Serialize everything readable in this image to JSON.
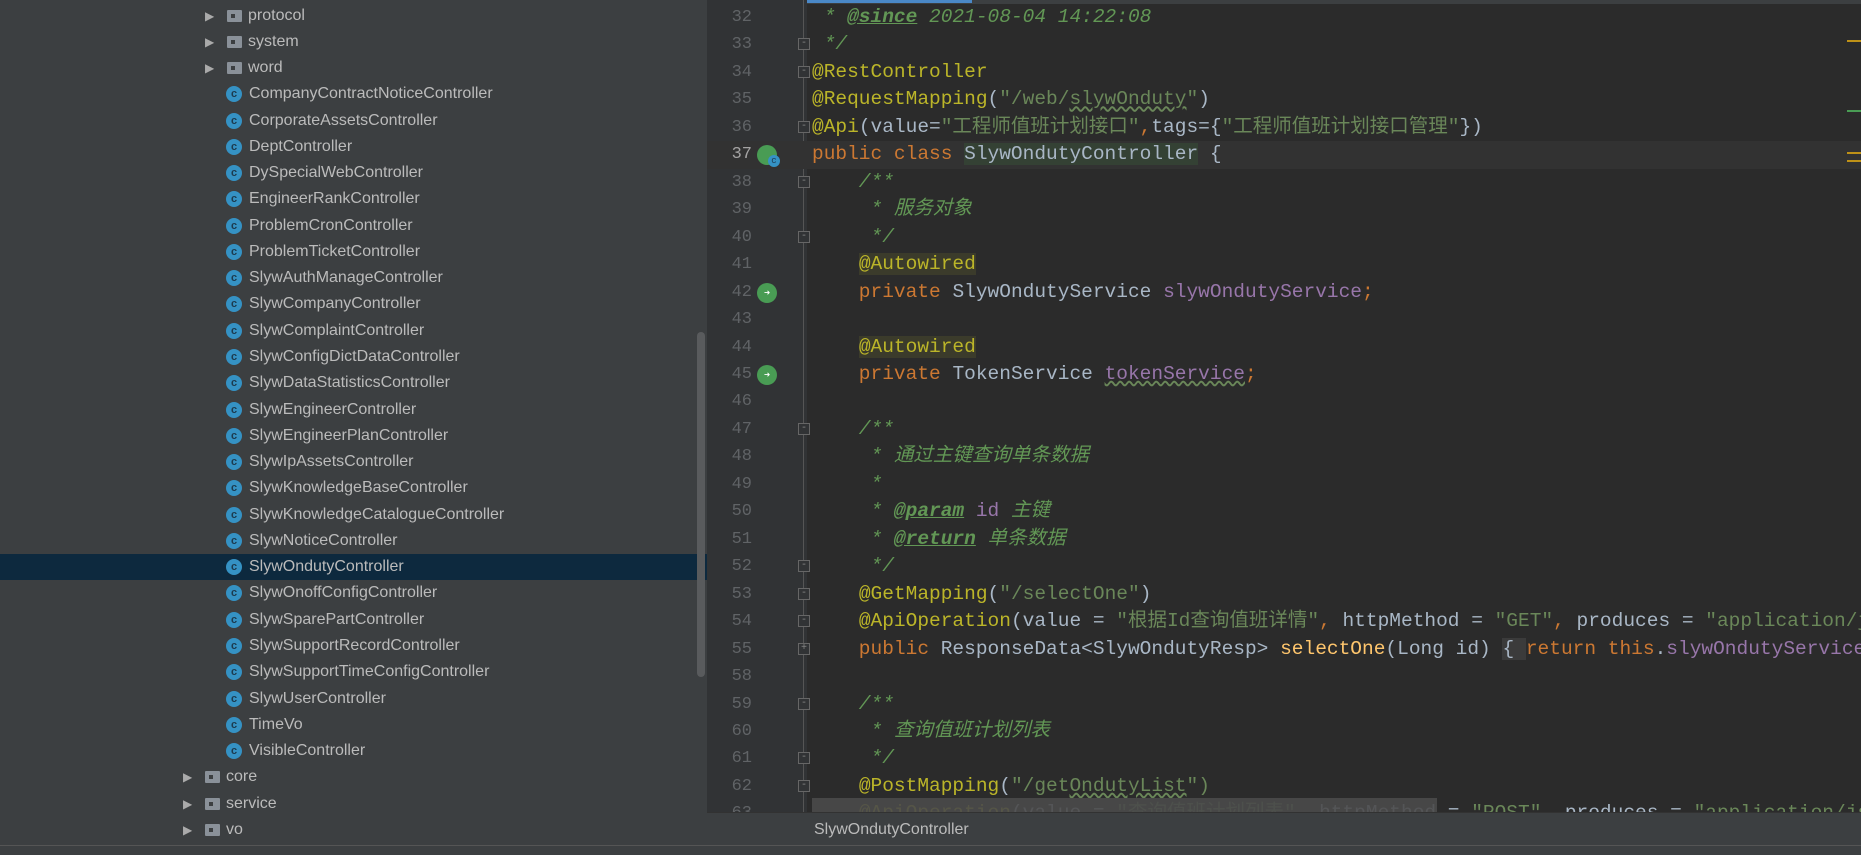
{
  "tree": {
    "items": [
      {
        "label": "protocol",
        "type": "folder",
        "level": 2
      },
      {
        "label": "system",
        "type": "folder",
        "level": 2
      },
      {
        "label": "word",
        "type": "folder",
        "level": 2
      },
      {
        "label": "CompanyContractNoticeController",
        "type": "class"
      },
      {
        "label": "CorporateAssetsController",
        "type": "class"
      },
      {
        "label": "DeptController",
        "type": "class"
      },
      {
        "label": "DySpecialWebController",
        "type": "class"
      },
      {
        "label": "EngineerRankController",
        "type": "class"
      },
      {
        "label": "ProblemCronController",
        "type": "class"
      },
      {
        "label": "ProblemTicketController",
        "type": "class"
      },
      {
        "label": "SlywAuthManageController",
        "type": "class"
      },
      {
        "label": "SlywCompanyController",
        "type": "class"
      },
      {
        "label": "SlywComplaintController",
        "type": "class"
      },
      {
        "label": "SlywConfigDictDataController",
        "type": "class"
      },
      {
        "label": "SlywDataStatisticsController",
        "type": "class"
      },
      {
        "label": "SlywEngineerController",
        "type": "class"
      },
      {
        "label": "SlywEngineerPlanController",
        "type": "class"
      },
      {
        "label": "SlywIpAssetsController",
        "type": "class"
      },
      {
        "label": "SlywKnowledgeBaseController",
        "type": "class"
      },
      {
        "label": "SlywKnowledgeCatalogueController",
        "type": "class"
      },
      {
        "label": "SlywNoticeController",
        "type": "class"
      },
      {
        "label": "SlywOndutyController",
        "type": "class",
        "selected": true
      },
      {
        "label": "SlywOnoffConfigController",
        "type": "class"
      },
      {
        "label": "SlywSparePartController",
        "type": "class"
      },
      {
        "label": "SlywSupportRecordController",
        "type": "class"
      },
      {
        "label": "SlywSupportTimeConfigController",
        "type": "class"
      },
      {
        "label": "SlywUserController",
        "type": "class"
      },
      {
        "label": "TimeVo",
        "type": "class"
      },
      {
        "label": "VisibleController",
        "type": "class"
      },
      {
        "label": "core",
        "type": "folder",
        "level": 1
      },
      {
        "label": "service",
        "type": "folder",
        "level": 1
      },
      {
        "label": "vo",
        "type": "folder",
        "level": 1
      }
    ],
    "class_icon_letter": "c"
  },
  "editor": {
    "current_line": "37",
    "lines": [
      {
        "n": "32",
        "t": [
          [
            " * ",
            "cm"
          ],
          [
            "@since",
            "tag"
          ],
          [
            " 2021-08-04 14:22:08",
            "cm"
          ]
        ]
      },
      {
        "n": "33",
        "fold": "-",
        "t": [
          [
            " */",
            "cm"
          ]
        ]
      },
      {
        "n": "34",
        "fold": "-",
        "t": [
          [
            "@RestController",
            "ann"
          ]
        ]
      },
      {
        "n": "35",
        "t": [
          [
            "@RequestMapping",
            "ann"
          ],
          [
            "(",
            "pl"
          ],
          [
            "\"/web/",
            "str"
          ],
          [
            "slywOnduty",
            "str wavy"
          ],
          [
            "\"",
            "str"
          ],
          [
            ")",
            "pl"
          ]
        ]
      },
      {
        "n": "36",
        "fold": "-",
        "t": [
          [
            "@Api",
            "ann"
          ],
          [
            "(value=",
            "pl"
          ],
          [
            "\"工程师值班计划接口\"",
            "str"
          ],
          [
            ",",
            "kw"
          ],
          [
            "tags={",
            "pl"
          ],
          [
            "\"工程师值班计划接口管理\"",
            "str"
          ],
          [
            "})",
            "pl"
          ]
        ]
      },
      {
        "n": "37",
        "icon": "class",
        "t": [
          [
            "public class ",
            "kw"
          ],
          [
            "SlywOndutyController",
            "pl cls-hl"
          ],
          [
            " {",
            "pl"
          ]
        ]
      },
      {
        "n": "38",
        "fold": "-",
        "t": [
          [
            "    /**",
            "cm"
          ]
        ]
      },
      {
        "n": "39",
        "t": [
          [
            "     * 服务对象",
            "cm"
          ]
        ]
      },
      {
        "n": "40",
        "fold": "-",
        "t": [
          [
            "     */",
            "cm"
          ]
        ]
      },
      {
        "n": "41",
        "t": [
          [
            "    ",
            "pl"
          ],
          [
            "@Autowired",
            "ann hl"
          ]
        ]
      },
      {
        "n": "42",
        "icon": "bean",
        "t": [
          [
            "    private ",
            "kw"
          ],
          [
            "SlywOndutyService ",
            "pl"
          ],
          [
            "slywOndutyService",
            "fld"
          ],
          [
            ";",
            "kw"
          ]
        ]
      },
      {
        "n": "43",
        "t": []
      },
      {
        "n": "44",
        "t": [
          [
            "    ",
            "pl"
          ],
          [
            "@Autowired",
            "ann hl"
          ]
        ]
      },
      {
        "n": "45",
        "icon": "bean",
        "t": [
          [
            "    private ",
            "kw"
          ],
          [
            "TokenService ",
            "pl"
          ],
          [
            "tokenService",
            "fld wavy"
          ],
          [
            ";",
            "kw"
          ]
        ]
      },
      {
        "n": "46",
        "t": []
      },
      {
        "n": "47",
        "fold": "-",
        "t": [
          [
            "    /**",
            "cm"
          ]
        ]
      },
      {
        "n": "48",
        "t": [
          [
            "     * 通过主键查询单条数据",
            "cm"
          ]
        ]
      },
      {
        "n": "49",
        "t": [
          [
            "     *",
            "cm"
          ]
        ]
      },
      {
        "n": "50",
        "t": [
          [
            "     * ",
            "cm"
          ],
          [
            "@param",
            "tag"
          ],
          [
            " ",
            "cm"
          ],
          [
            "id",
            "fld"
          ],
          [
            " 主键",
            "cm"
          ]
        ]
      },
      {
        "n": "51",
        "t": [
          [
            "     * ",
            "cm"
          ],
          [
            "@return",
            "tag"
          ],
          [
            " 单条数据",
            "cm"
          ]
        ]
      },
      {
        "n": "52",
        "fold": "-",
        "t": [
          [
            "     */",
            "cm"
          ]
        ]
      },
      {
        "n": "53",
        "fold": "-",
        "t": [
          [
            "    ",
            "pl"
          ],
          [
            "@GetMapping",
            "ann"
          ],
          [
            "(",
            "pl"
          ],
          [
            "\"/selectOne\"",
            "str"
          ],
          [
            ")",
            "pl"
          ]
        ]
      },
      {
        "n": "54",
        "fold": "-",
        "t": [
          [
            "    ",
            "pl"
          ],
          [
            "@ApiOperation",
            "ann"
          ],
          [
            "(value = ",
            "pl"
          ],
          [
            "\"根据Id查询值班详情\"",
            "str"
          ],
          [
            ", ",
            "kw"
          ],
          [
            "httpMethod = ",
            "pl"
          ],
          [
            "\"GET\"",
            "str"
          ],
          [
            ", ",
            "kw"
          ],
          [
            "produces = ",
            "pl"
          ],
          [
            "\"application/json\"",
            "str"
          ]
        ]
      },
      {
        "n": "55",
        "fold": "+",
        "t": [
          [
            "    public ",
            "kw"
          ],
          [
            "ResponseData<SlywOndutyResp> ",
            "pl"
          ],
          [
            "selectOne",
            "mth"
          ],
          [
            "(Long id) ",
            "pl"
          ],
          [
            "{ ",
            "pl brc"
          ],
          [
            "return this",
            "kw"
          ],
          [
            ".",
            "pl"
          ],
          [
            "slywOndutyService",
            "fld"
          ]
        ]
      },
      {
        "n": "58",
        "t": []
      },
      {
        "n": "59",
        "fold": "-",
        "t": [
          [
            "    /**",
            "cm"
          ]
        ]
      },
      {
        "n": "60",
        "t": [
          [
            "     * 查询值班计划列表",
            "cm"
          ]
        ]
      },
      {
        "n": "61",
        "fold": "-",
        "t": [
          [
            "     */",
            "cm"
          ]
        ]
      },
      {
        "n": "62",
        "fold": "-",
        "t": [
          [
            "    ",
            "pl"
          ],
          [
            "@PostMapping",
            "ann"
          ],
          [
            "(",
            "pl"
          ],
          [
            "\"/get",
            "str"
          ],
          [
            "OndutyList",
            "str wavy"
          ],
          [
            "\")",
            "str"
          ]
        ]
      },
      {
        "n": "63",
        "t": [
          [
            "    ",
            "pl"
          ],
          [
            "@ApiOperation",
            "ann"
          ],
          [
            "(value = ",
            "pl"
          ],
          [
            "\"查询值班计划列表\"",
            "str"
          ],
          [
            ", ",
            "kw"
          ],
          [
            "httpMethod = ",
            "pl"
          ],
          [
            "\"POST\"",
            "str"
          ],
          [
            ", ",
            "kw"
          ],
          [
            "produces = ",
            "pl"
          ],
          [
            "\"application/json\"",
            "str"
          ]
        ]
      }
    ]
  },
  "breadcrumb": {
    "label": "SlywOndutyController"
  },
  "colors": {
    "annotation": "#bbb529",
    "keyword": "#cc7832",
    "string": "#6a8759",
    "comment": "#629755",
    "field": "#9876aa",
    "selection": "#0d293e"
  }
}
